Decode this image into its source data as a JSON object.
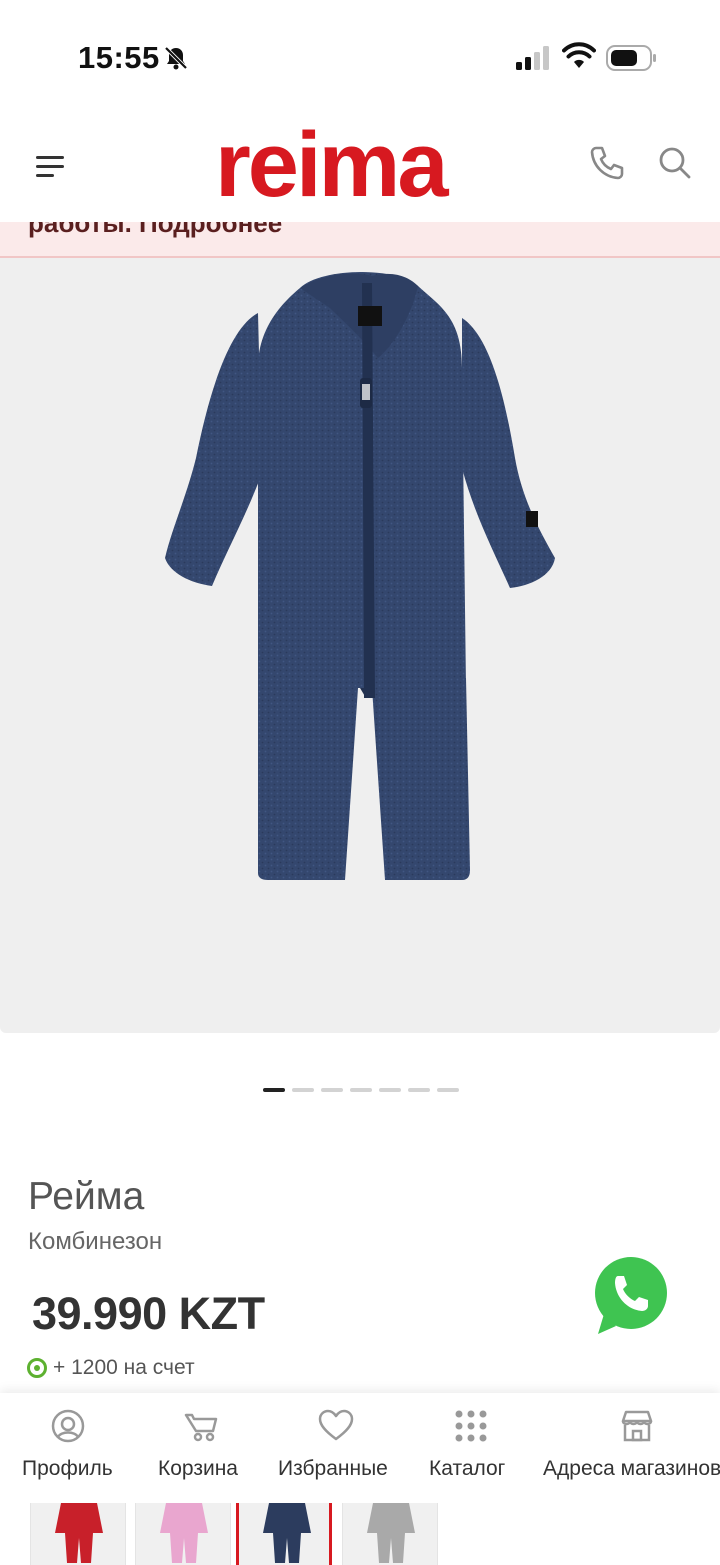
{
  "status_bar": {
    "time": "15:55"
  },
  "header": {
    "logo_text": "reima"
  },
  "notice": {
    "text": "работы. Подробнее"
  },
  "carousel": {
    "total": 7,
    "active_index": 0
  },
  "product": {
    "brand": "Рейма",
    "type": "Комбинезон",
    "price": "39.990 KZT",
    "bonus": "+ 1200 на счет"
  },
  "bottom_nav": {
    "profile": "Профиль",
    "cart": "Корзина",
    "favorites": "Избранные",
    "catalog": "Каталог",
    "stores": "Адреса магазинов"
  },
  "colors": {
    "brand_red": "#d71920",
    "whatsapp_green": "#3fc451",
    "bonus_green": "#5db130",
    "suit_navy": "#34476e"
  },
  "thumbnails": [
    {
      "color_name": "red",
      "color": "#c8202a"
    },
    {
      "color_name": "pink",
      "color": "#e9a6cf"
    },
    {
      "color_name": "navy",
      "color": "#2c3c5e",
      "selected": true
    },
    {
      "color_name": "grey",
      "color": "#a9a9a9"
    }
  ]
}
